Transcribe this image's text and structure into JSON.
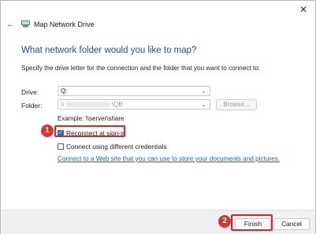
{
  "window": {
    "close_glyph": "✕"
  },
  "header": {
    "back_glyph": "←",
    "title": "Map Network Drive"
  },
  "main": {
    "heading": "What network folder would you like to map?",
    "description": "Specify the drive letter for the connection and the folder that you want to connect to:",
    "drive": {
      "label": "Drive:",
      "value": "Q:"
    },
    "folder": {
      "label": "Folder:",
      "value_prefix": "\\\\",
      "value_suffix": "\\QB"
    },
    "browse_label": "Browse...",
    "example": "Example: \\\\server\\share",
    "reconnect": {
      "label": "Reconnect at sign-in",
      "checked": true
    },
    "diffcreds": {
      "label": "Connect using different credentials",
      "checked": false
    },
    "link": "Connect to a Web site that you can use to store your documents and pictures."
  },
  "footer": {
    "finish_label": "Finish",
    "cancel_label": "Cancel"
  },
  "annotations": {
    "badge1": "1",
    "badge2": "2",
    "highlight_color": "#d8262b"
  },
  "colors": {
    "heading": "#1f4e9a",
    "link": "#1a63c9",
    "checkbox": "#1f6fd1"
  }
}
